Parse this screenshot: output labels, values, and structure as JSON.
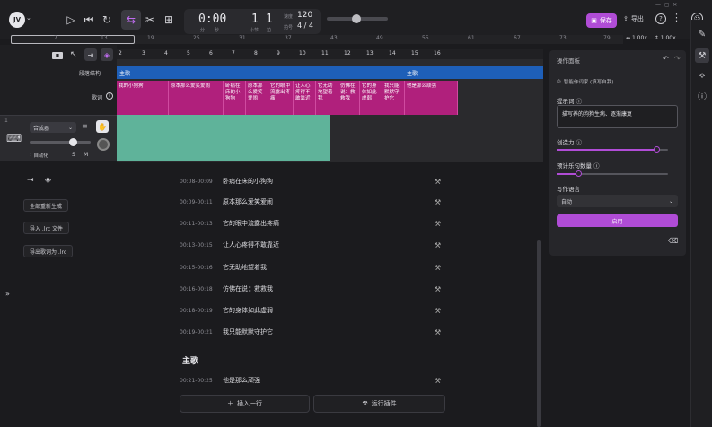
{
  "toolbar": {
    "time": "0:00",
    "time_sub1": "分",
    "time_sub2": "秒",
    "bar": "1",
    "beat": "1",
    "bar_sub": "小节",
    "beat_sub": "拍",
    "tempo_label": "速度",
    "tempo": "120",
    "sig_label": "拍号",
    "signature": "4 / 4",
    "save_label": "保存",
    "export_label": "导出"
  },
  "ruler": {
    "ticks": [
      "7",
      "13",
      "19",
      "25",
      "31",
      "37",
      "43",
      "49",
      "55",
      "61",
      "67",
      "73",
      "79"
    ],
    "zoom1": "1.00x",
    "zoom2": "1.00x"
  },
  "timeline": {
    "beats": [
      "2",
      "3",
      "4",
      "5",
      "6",
      "7",
      "8",
      "9",
      "10",
      "11",
      "12",
      "13",
      "14",
      "15",
      "16"
    ],
    "struct_label": "段落结构",
    "lyrics_label": "歌词",
    "section_verse": "主歌",
    "section_chorus": "主歌",
    "lyric_blocks": [
      "我的小狗狗",
      "原本那么爱笑爱闹",
      "卧病在床的小狗狗",
      "原本那么爱笑爱闹",
      "它的眼中流露出疼痛",
      "让人心疼得不敢靠近",
      "它无助地望着我",
      "仿佛在说：救救我",
      "它的身体如此虚弱",
      "我只能默默守护它",
      "他是那么顽强"
    ]
  },
  "track": {
    "number": "1",
    "instrument": "合成器",
    "automation_label": "自动化",
    "solo": "S",
    "mute": "M"
  },
  "left_actions": {
    "regen_all": "全部重新生成",
    "import_lrc": "导入 .lrc 文件",
    "export_lrc": "导出歌词为 .lrc"
  },
  "lyric_list": {
    "rows": [
      {
        "time": "00:08-00:09",
        "text": "卧病在床的小狗狗"
      },
      {
        "time": "00:09-00:11",
        "text": "原本那么爱笑爱闹"
      },
      {
        "time": "00:11-00:13",
        "text": "它的眼中流露出疼痛"
      },
      {
        "time": "00:13-00:15",
        "text": "让人心疼得不敢靠近"
      },
      {
        "time": "00:15-00:16",
        "text": "它无助地望着我"
      },
      {
        "time": "00:16-00:18",
        "text": "仿佛在说：救救我"
      },
      {
        "time": "00:18-00:19",
        "text": "它的身体如此虚弱"
      },
      {
        "time": "00:19-00:21",
        "text": "我只能默默守护它"
      }
    ],
    "section_title": "主歌",
    "section_rows": [
      {
        "time": "00:21-00:25",
        "text": "他是那么顽强"
      }
    ],
    "insert_row": "插入一行",
    "run_all": "运行插件"
  },
  "right_panel": {
    "title": "操作面板",
    "option_label": "智能作词家 (填写自我)",
    "prompt_label": "提示词",
    "prompt_value": "描写养的狗狗生病、逐渐康复",
    "creativity_label": "创造力",
    "creativity_value": 0.9,
    "lines_label": "预计乐句数量",
    "lines_value": 0.2,
    "language_label": "写作语言",
    "language_value": "自动",
    "start_label": "启用"
  },
  "colors": {
    "accent": "#b04cd6",
    "lyric_block": "#b0207c",
    "structure": "#1e5fb8",
    "audio_clip": "#5fb39a"
  }
}
